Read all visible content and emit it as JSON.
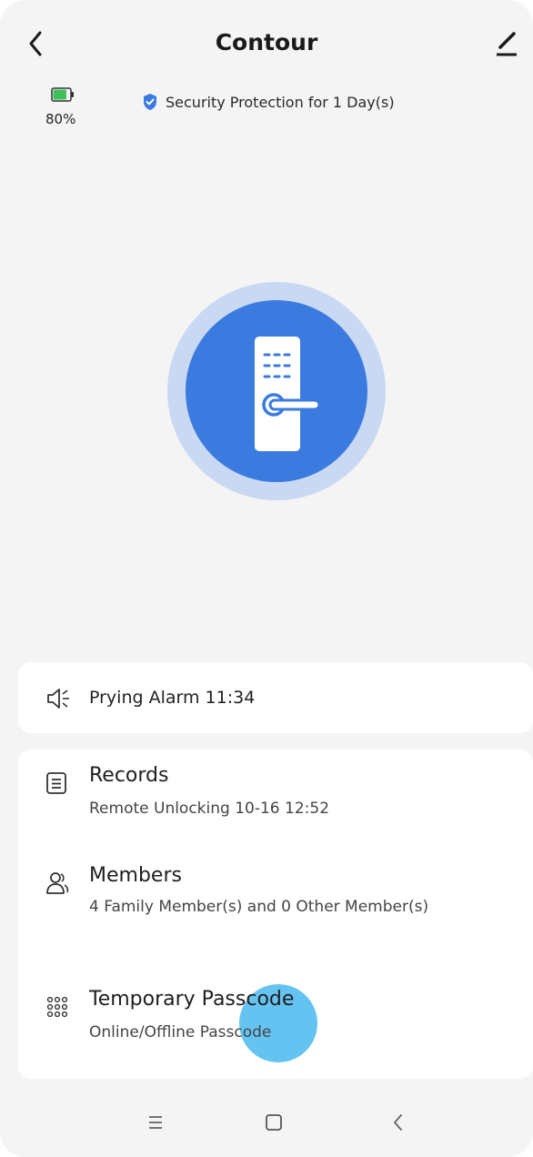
{
  "header": {
    "title": "Contour",
    "back_icon": "chevron-left-icon",
    "edit_icon": "pencil-icon"
  },
  "status": {
    "battery_percent": "80%",
    "battery_level": 0.8,
    "battery_color": "#3fbf5a",
    "security_text": "Security Protection for 1 Day(s)",
    "security_icon": "shield-check-icon",
    "security_color": "#3b7be0"
  },
  "lock": {
    "icon": "door-lock-icon",
    "primary_color": "#3b7be0",
    "halo_color": "#c9d9f3"
  },
  "alarm": {
    "icon": "speaker-alarm-icon",
    "text": "Prying Alarm 11:34"
  },
  "menu": {
    "records": {
      "icon": "document-list-icon",
      "title": "Records",
      "subtitle": "Remote Unlocking 10-16 12:52"
    },
    "members": {
      "icon": "users-icon",
      "title": "Members",
      "subtitle": "4 Family Member(s) and 0 Other Member(s)"
    },
    "temporary_passcode": {
      "icon": "keypad-icon",
      "title": "Temporary Passcode",
      "subtitle": "Online/Offline Passcode"
    }
  },
  "navbar": {
    "menu_icon": "menu-icon",
    "home_icon": "home-square-icon",
    "back_icon": "back-chevron-icon"
  }
}
